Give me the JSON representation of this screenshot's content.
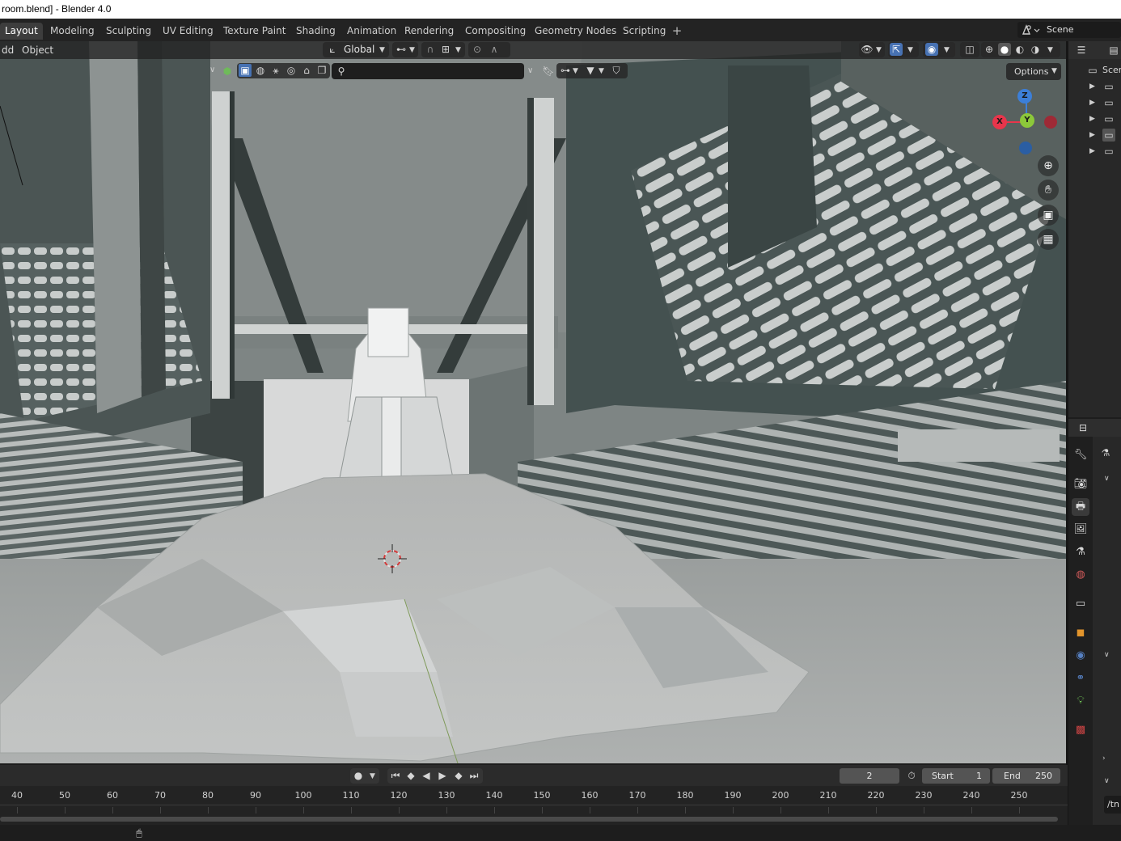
{
  "window": {
    "title": "[...]room.blend] - Blender 4.0",
    "title_visible": "room.blend] - Blender 4.0"
  },
  "workspaces": [
    {
      "label": "Layout",
      "active": true
    },
    {
      "label": "Modeling"
    },
    {
      "label": "Sculpting"
    },
    {
      "label": "UV Editing"
    },
    {
      "label": "Texture Paint"
    },
    {
      "label": "Shading"
    },
    {
      "label": "Animation"
    },
    {
      "label": "Rendering"
    },
    {
      "label": "Compositing"
    },
    {
      "label": "Geometry Nodes"
    },
    {
      "label": "Scripting"
    }
  ],
  "scene_selector": {
    "label": "Scene"
  },
  "viewport_header": {
    "add_menu": "dd",
    "object_menu": "Object",
    "transform_orientation": "Global",
    "options_label": "Options"
  },
  "gizmo": {
    "x": "X",
    "y": "Y",
    "z": "Z"
  },
  "outliner": {
    "scene_label": "Scer"
  },
  "timeline": {
    "current_frame": "2",
    "start_label": "Start",
    "start_value": "1",
    "end_label": "End",
    "end_value": "250",
    "ticks": [
      "40",
      "50",
      "60",
      "70",
      "80",
      "90",
      "100",
      "110",
      "120",
      "130",
      "140",
      "150",
      "160",
      "170",
      "180",
      "190",
      "200",
      "210",
      "220",
      "230",
      "240",
      "250"
    ]
  },
  "properties": {
    "path_field": "/tn"
  },
  "colors": {
    "axis_x": "#e8354b",
    "axis_y": "#8cc83a",
    "axis_z": "#3c7fd8",
    "active_icon": "#5680c2",
    "orange_icon": "#e3952c"
  }
}
